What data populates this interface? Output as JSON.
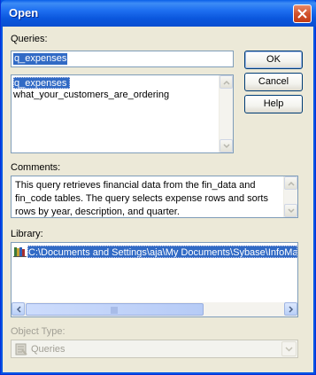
{
  "window": {
    "title": "Open"
  },
  "queries": {
    "label": "Queries:",
    "input_value": "q_expenses",
    "items": [
      {
        "label": "q_expenses",
        "selected": true
      },
      {
        "label": "what_your_customers_are_ordering",
        "selected": false
      }
    ]
  },
  "buttons": {
    "ok": "OK",
    "cancel": "Cancel",
    "help": "Help"
  },
  "comments": {
    "label": "Comments:",
    "text": "This query retrieves financial data from the fin_data and fin_code tables. The query selects expense rows and sorts rows by year, description, and quarter."
  },
  "library": {
    "label": "Library:",
    "items": [
      {
        "label": "C:\\Documents and Settings\\aja\\My Documents\\Sybase\\InfoMa",
        "icon": "library-icon",
        "selected": true
      }
    ]
  },
  "object_type": {
    "label": "Object Type:",
    "value": "Queries",
    "icon": "queries-icon"
  },
  "colors": {
    "selection": "#316ac5",
    "dialog_bg": "#ece9d8",
    "titlebar": "#0a56dd",
    "border": "#7f9db9"
  }
}
